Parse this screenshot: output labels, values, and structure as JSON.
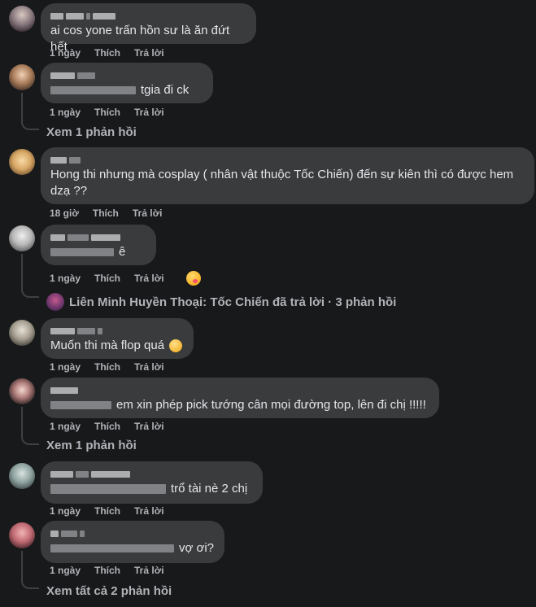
{
  "comments": [
    {
      "text": "ai cos yone trấn hồn sư là ăn đứt hết",
      "time": "1 ngày",
      "like": "Thích",
      "reply": "Trả lời"
    },
    {
      "text": "tgia đi ck",
      "time": "1 ngày",
      "like": "Thích",
      "reply": "Trả lời",
      "see_replies": "Xem 1 phản hồi"
    },
    {
      "text": "Hong thi nhưng mà cosplay ( nhân vật thuộc Tốc Chiến) đến sự kiên thì có được hem dzạ ??",
      "time": "18 giờ",
      "like": "Thích",
      "reply": "Trả lời"
    },
    {
      "text": "ê",
      "time": "1 ngày",
      "like": "Thích",
      "reply": "Trả lời",
      "reaction": "emoji-reaction",
      "page_reply": "Liên Minh Huyền Thoại: Tốc Chiến đã trả lời · 3 phản hồi"
    },
    {
      "text": "Muốn thi mà flop quá",
      "time": "1 ngày",
      "like": "Thích",
      "reply": "Trả lời"
    },
    {
      "text": "em xin phép pick tướng cân mọi đường top, lên đi chị !!!!!",
      "time": "1 ngày",
      "like": "Thích",
      "reply": "Trả lời",
      "see_replies": "Xem 1 phản hồi"
    },
    {
      "text": "trổ tài nè 2 chị",
      "time": "1 ngày",
      "like": "Thích",
      "reply": "Trả lời"
    },
    {
      "text": "vợ ơi?",
      "time": "1 ngày",
      "like": "Thích",
      "reply": "Trả lời",
      "see_replies": "Xem tất cả 2 phản hồi"
    }
  ],
  "colors": {
    "background": "#18191a",
    "bubble": "#3a3b3c",
    "text": "#e4e6eb",
    "muted": "#b0b3b8"
  }
}
